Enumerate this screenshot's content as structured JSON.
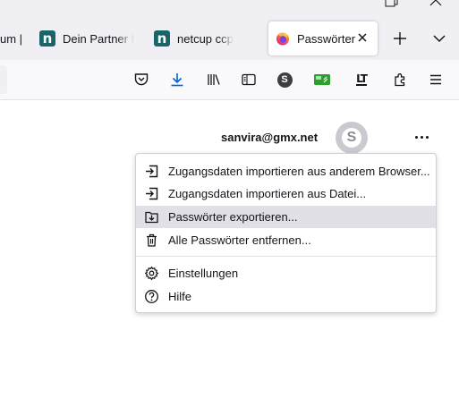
{
  "tabs": [
    {
      "label": "um |",
      "favicon": "none"
    },
    {
      "label": "Dein Partner f",
      "favicon": "netcup-icon"
    },
    {
      "label": "netcup ccp",
      "favicon": "netcup-icon"
    },
    {
      "label": "Passwörter",
      "favicon": "firefox-icon",
      "active": true
    }
  ],
  "favicon_letter": "n",
  "toolbar": {
    "icons": [
      "pocket-icon",
      "downloads-icon",
      "library-icon",
      "sidebar-icon",
      "account-icon",
      "extension-green-icon",
      "languagetool-icon",
      "extensions-icon",
      "menu-icon"
    ],
    "account_letter": "S",
    "languagetool_text": "LT"
  },
  "account": {
    "email": "sanvira@gmx.net",
    "avatar_letter": "S"
  },
  "menu": {
    "items": [
      {
        "label": "Zugangsdaten importieren aus anderem Browser...",
        "icon": "import-icon"
      },
      {
        "label": "Zugangsdaten importieren aus Datei...",
        "icon": "import-file-icon"
      },
      {
        "label": "Passwörter exportieren...",
        "icon": "export-icon",
        "highlighted": true
      },
      {
        "label": "Alle Passwörter entfernen...",
        "icon": "trash-icon"
      },
      {
        "label": "Einstellungen",
        "icon": "settings-icon"
      },
      {
        "label": "Hilfe",
        "icon": "help-icon"
      }
    ]
  },
  "colors": {
    "tabbar_bg": "#f0f0f4",
    "navbar_bg": "#f9f9fb",
    "netcup_teal": "#1a6469",
    "download_blue": "#0061e0",
    "menu_hover": "#e0e0e6",
    "avatar_gray": "#c9c9cf"
  }
}
